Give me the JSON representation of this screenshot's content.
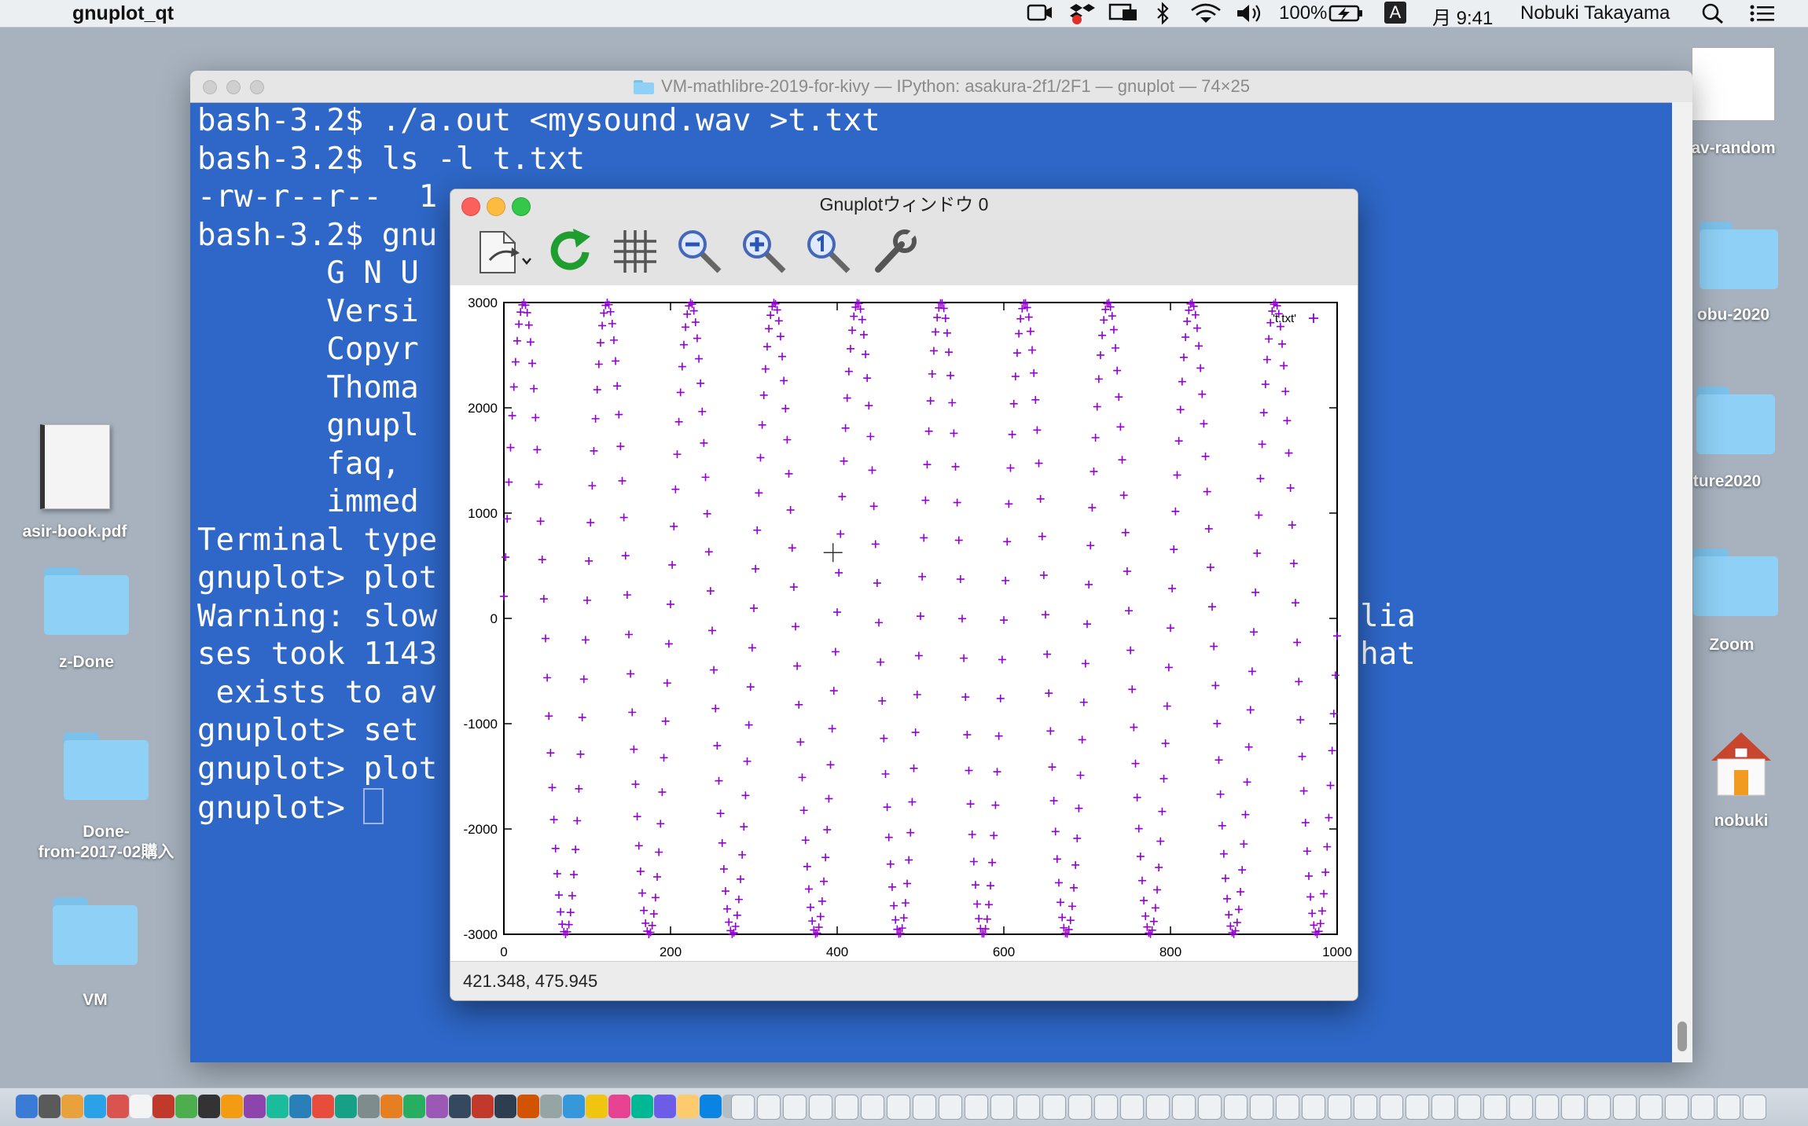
{
  "menubar": {
    "app_name": "gnuplot_qt",
    "battery": "100%",
    "input_mode": "A",
    "clock": "月 9:41",
    "user": "Nobuki Takayama"
  },
  "desktop_left": [
    {
      "label": "asir-book.pdf"
    },
    {
      "label": "z-Done"
    },
    {
      "label": "Done-\nfrom-2017-02購入"
    },
    {
      "label": "VM"
    }
  ],
  "desktop_right": [
    {
      "label": "av-random"
    },
    {
      "label": "obu-2020"
    },
    {
      "label": "ture2020"
    },
    {
      "label": "Zoom"
    },
    {
      "label": "nobuki"
    }
  ],
  "terminal": {
    "title": "VM-mathlibre-2019-for-kivy — IPython: asakura-2f1/2F1 — gnuplot — 74×25",
    "lines": [
      "bash-3.2$ ./a.out <mysound.wav >t.txt",
      "bash-3.2$ ls -l t.txt",
      "-rw-r--r--  1",
      "bash-3.2$ gnu",
      "",
      "       G N U",
      "       Versi                                              13",
      "",
      "       Copyr",
      "       Thoma",
      "",
      "       gnupl",
      "       faq,",
      "       immed                                             n')",
      "",
      "Terminal type",
      "gnuplot> plot",
      "",
      "Warning: slow                                     font family alia",
      "ses took 1143                                     s\" with one that",
      " exists to av",
      "",
      "gnuplot> set",
      "gnuplot> plot"
    ],
    "prompt": "gnuplot> "
  },
  "gnuplot_window": {
    "title": "Gnuplotウィンドウ 0",
    "toolbar": {
      "export": "export-icon",
      "replot": "replot-icon",
      "grid": "grid-icon",
      "zoom_out": "zoom-out-icon",
      "zoom_in": "zoom-in-icon",
      "zoom_reset": "zoom-reset-icon",
      "settings": "wrench-icon"
    },
    "status": "421.348,  475.945"
  },
  "chart_data": {
    "type": "scatter",
    "title": "",
    "xlabel": "",
    "ylabel": "",
    "xlim": [
      0,
      1000
    ],
    "ylim": [
      -3000,
      3000
    ],
    "xticks": [
      0,
      200,
      400,
      600,
      800,
      1000
    ],
    "yticks": [
      3000,
      2000,
      1000,
      0,
      -1000,
      -2000,
      -3000
    ],
    "grid": false,
    "legend": "top-right",
    "marker": "+",
    "color": "#9400d3",
    "series": [
      {
        "name": "'t.txt'",
        "amplitude": 3000,
        "period": 100.2,
        "phase_degrees": 4,
        "x_step": 2,
        "x_range": [
          0,
          1000
        ]
      }
    ]
  },
  "colors": {
    "terminal_bg": "#2e67c7",
    "plot_marker": "#9400d3"
  }
}
